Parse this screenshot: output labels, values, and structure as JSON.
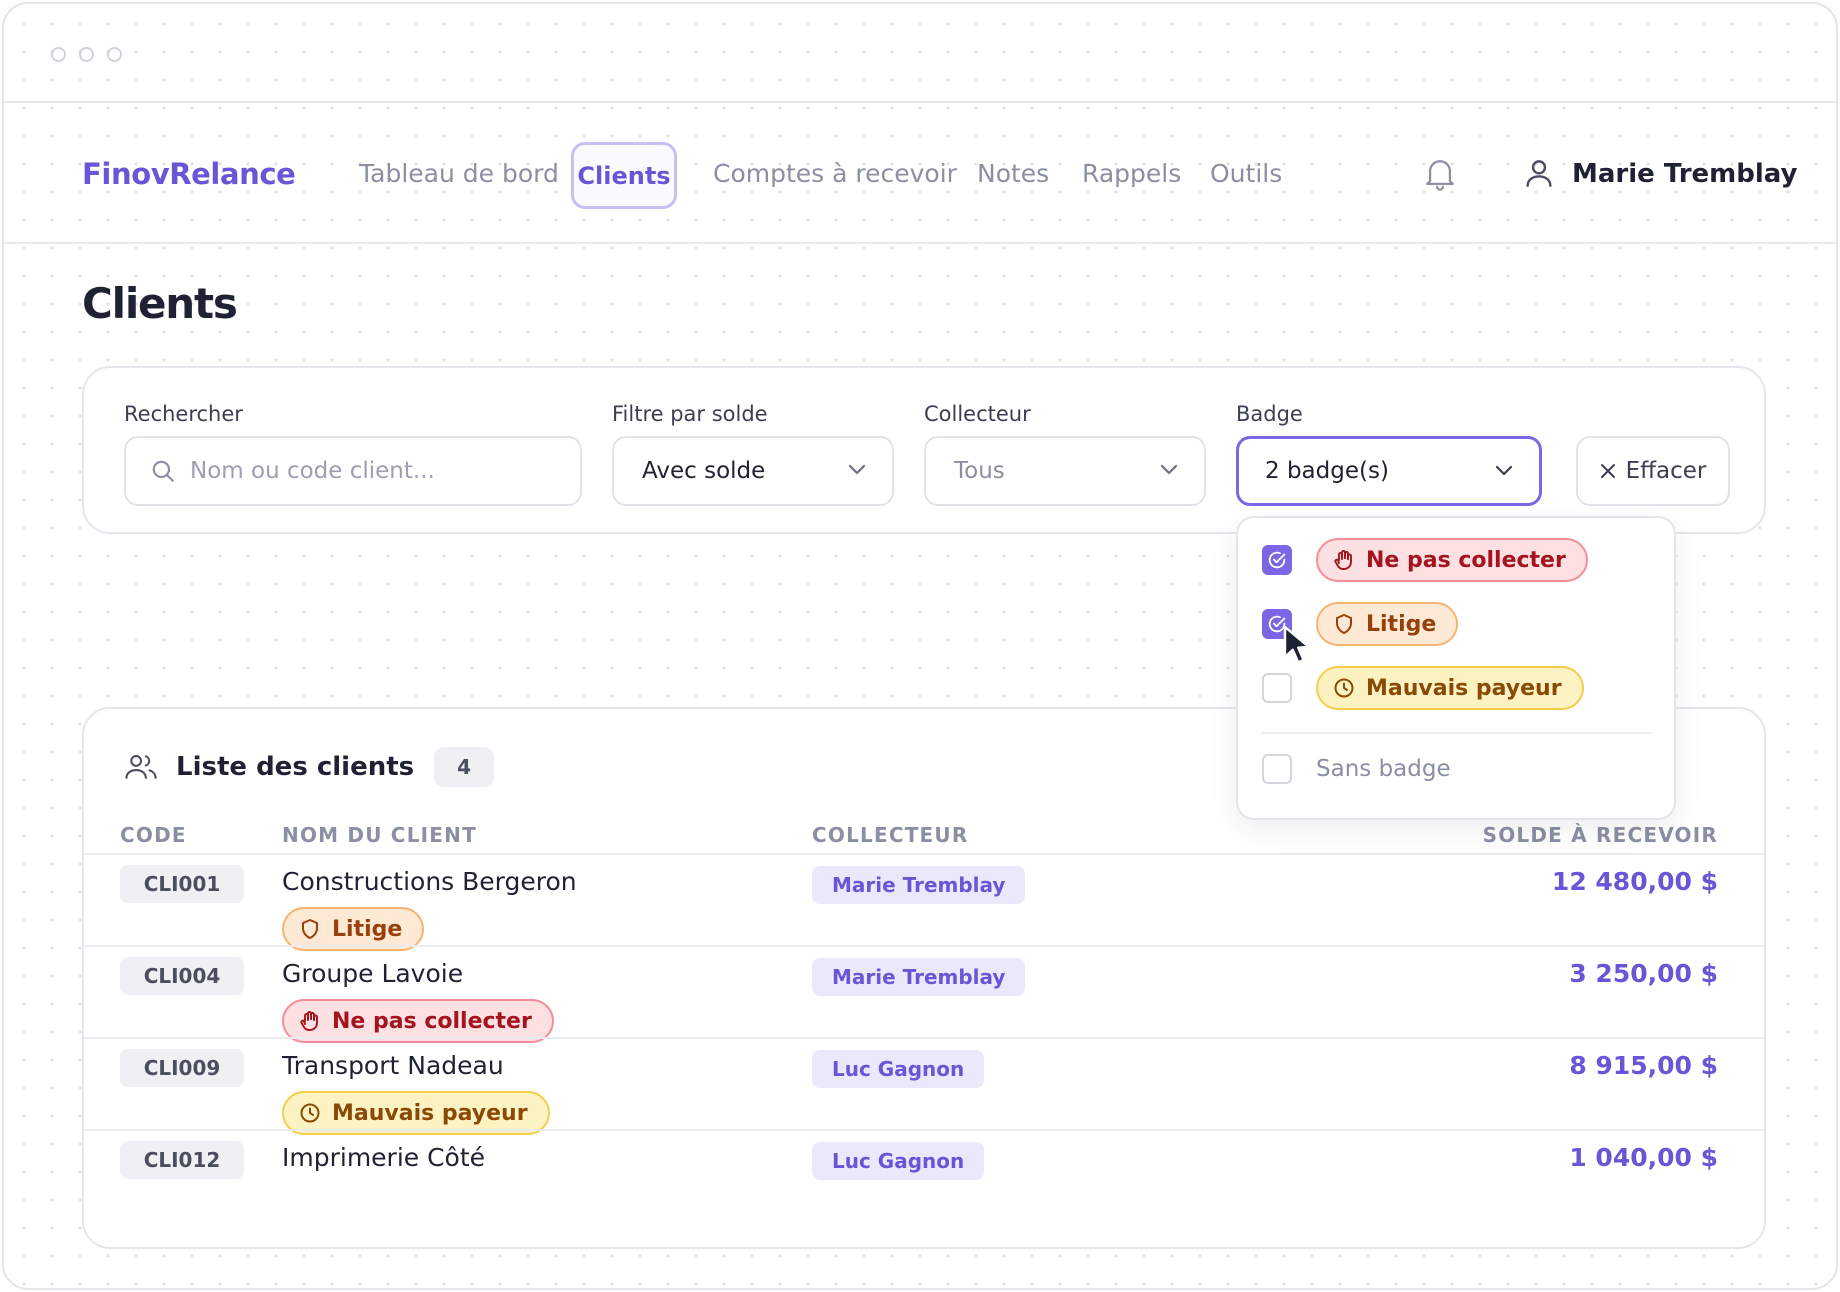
{
  "window": {
    "controls": [
      "close",
      "minimize",
      "maximize"
    ]
  },
  "nav": {
    "brand": "FinovRelance",
    "links": [
      "Tableau de bord",
      "Clients",
      "Comptes à recevoir",
      "Notes",
      "Rappels",
      "Outils"
    ],
    "active": "Clients",
    "user_name": "Marie Tremblay",
    "icons": [
      "bell-icon",
      "user-icon"
    ]
  },
  "page": {
    "title": "Clients"
  },
  "filters": {
    "search": {
      "label": "Rechercher",
      "placeholder": "Nom ou code client..."
    },
    "solde": {
      "label": "Filtre par solde",
      "value": "Avec solde"
    },
    "collecteur": {
      "label": "Collecteur",
      "value": "Tous"
    },
    "badge": {
      "label": "Badge",
      "value": "2 badge(s)"
    },
    "clear_label": "Effacer"
  },
  "badge_dropdown": {
    "options": [
      {
        "label": "Ne pas collecter",
        "checked": true,
        "icon": "hand-icon",
        "color": "#a3141f"
      },
      {
        "label": "Litige",
        "checked": true,
        "icon": "shield-icon",
        "color": "#98400b"
      },
      {
        "label": "Mauvais payeur",
        "checked": false,
        "icon": "clock-icon",
        "color": "#8a4a06"
      }
    ],
    "no_badge": {
      "label": "Sans badge",
      "checked": false
    }
  },
  "list": {
    "title": "Liste des clients",
    "count": "4",
    "columns": [
      "CODE",
      "NOM DU CLIENT",
      "COLLECTEUR",
      "SOLDE À RECEVOIR"
    ],
    "rows": [
      {
        "code": "CLI001",
        "name": "Constructions Bergeron",
        "badge": "Litige",
        "collector": "Marie Tremblay",
        "solde": "12 480,00 $"
      },
      {
        "code": "CLI004",
        "name": "Groupe Lavoie",
        "badge": "Ne pas collecter",
        "collector": "Marie Tremblay",
        "solde": "3 250,00 $"
      },
      {
        "code": "CLI009",
        "name": "Transport Nadeau",
        "badge": "Mauvais payeur",
        "collector": "Luc Gagnon",
        "solde": "8 915,00 $"
      },
      {
        "code": "CLI012",
        "name": "Imprimerie Côté",
        "badge": "",
        "collector": "Luc Gagnon",
        "solde": "1 040,00 $"
      }
    ]
  },
  "colors": {
    "accent": "#6b55d6",
    "focus": "#7d66e3"
  }
}
